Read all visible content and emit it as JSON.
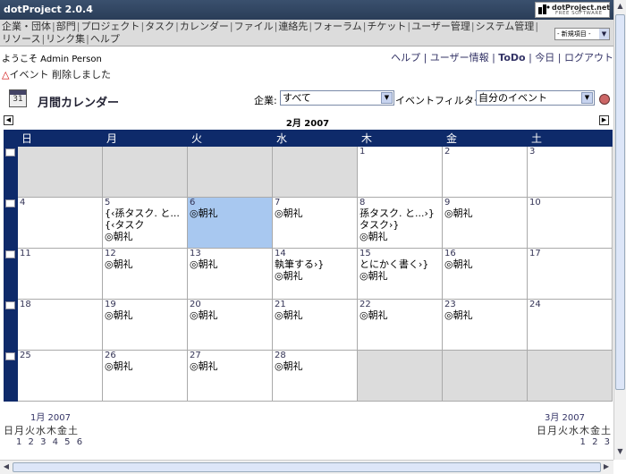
{
  "app": {
    "title": "dotProject 2.0.4",
    "logo_line1": "dotProject.net",
    "logo_line2": "FREE SOFTWARE"
  },
  "menu": {
    "items": [
      "企業・団体",
      "部門",
      "プロジェクト",
      "タスク",
      "カレンダー",
      "ファイル",
      "連絡先",
      "フォーラム",
      "チケット",
      "ユーザー管理",
      "システム管理",
      "リソース",
      "リンク集",
      "ヘルプ"
    ],
    "new_item_label": "- 新規項目 -"
  },
  "welcome": "ようこそ Admin Person",
  "user_nav": {
    "help": "ヘルプ",
    "user_info": "ユーザー情報",
    "todo": "ToDo",
    "today": "今日",
    "logout": "ログアウト"
  },
  "notice": {
    "icon": "warning-icon",
    "text": "イベント 削除しました"
  },
  "page": {
    "title": "月間カレンダー",
    "company_label": "企業:",
    "company_value": "すべて",
    "event_filter_label": "イベントフィルター:",
    "event_filter_value": "自分のイベント"
  },
  "calendar": {
    "month_label": "2月 2007",
    "weekdays": [
      "日",
      "月",
      "火",
      "水",
      "木",
      "金",
      "土"
    ],
    "weeks": [
      [
        {
          "d": "",
          "events": []
        },
        {
          "d": "",
          "events": []
        },
        {
          "d": "",
          "events": []
        },
        {
          "d": "",
          "events": []
        },
        {
          "d": "1",
          "events": []
        },
        {
          "d": "2",
          "events": []
        },
        {
          "d": "3",
          "events": []
        }
      ],
      [
        {
          "d": "4",
          "events": []
        },
        {
          "d": "5",
          "events": [
            "{‹孫タスク. と...",
            "{‹タスク",
            "◎朝礼"
          ]
        },
        {
          "d": "6",
          "events": [
            "◎朝礼"
          ],
          "today": true
        },
        {
          "d": "7",
          "events": [
            "◎朝礼"
          ]
        },
        {
          "d": "8",
          "events": [
            "孫タスク. と...›}",
            "タスク›}",
            "◎朝礼"
          ]
        },
        {
          "d": "9",
          "events": [
            "◎朝礼"
          ]
        },
        {
          "d": "10",
          "events": []
        }
      ],
      [
        {
          "d": "11",
          "events": []
        },
        {
          "d": "12",
          "events": [
            "◎朝礼"
          ]
        },
        {
          "d": "13",
          "events": [
            "◎朝礼"
          ]
        },
        {
          "d": "14",
          "events": [
            "執筆する›}",
            "◎朝礼"
          ]
        },
        {
          "d": "15",
          "events": [
            "とにかく書く›}",
            "◎朝礼"
          ]
        },
        {
          "d": "16",
          "events": [
            "◎朝礼"
          ]
        },
        {
          "d": "17",
          "events": []
        }
      ],
      [
        {
          "d": "18",
          "events": []
        },
        {
          "d": "19",
          "events": [
            "◎朝礼"
          ]
        },
        {
          "d": "20",
          "events": [
            "◎朝礼"
          ]
        },
        {
          "d": "21",
          "events": [
            "◎朝礼"
          ]
        },
        {
          "d": "22",
          "events": [
            "◎朝礼"
          ]
        },
        {
          "d": "23",
          "events": [
            "◎朝礼"
          ]
        },
        {
          "d": "24",
          "events": []
        }
      ],
      [
        {
          "d": "25",
          "events": []
        },
        {
          "d": "26",
          "events": [
            "◎朝礼"
          ]
        },
        {
          "d": "27",
          "events": [
            "◎朝礼"
          ]
        },
        {
          "d": "28",
          "events": [
            "◎朝礼"
          ]
        },
        {
          "d": "",
          "events": [],
          "empty": true
        },
        {
          "d": "",
          "events": [],
          "empty": true
        },
        {
          "d": "",
          "events": [],
          "empty": true
        }
      ]
    ]
  },
  "mini_prev": {
    "label": "1月 2007",
    "days": "日月火水木金土",
    "nums": "1 2 3 4 5 6"
  },
  "mini_next": {
    "label": "3月 2007",
    "days": "日月火水木金土",
    "nums": "1 2 3"
  }
}
